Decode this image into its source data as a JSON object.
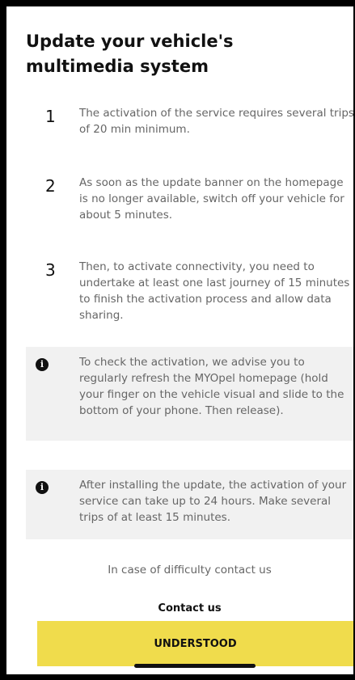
{
  "page": {
    "title": "Update your vehicle's multimedia system"
  },
  "steps": [
    {
      "number": "1",
      "text": "The activation of the service requires several trips of 20 min minimum."
    },
    {
      "number": "2",
      "text": "As soon as the update banner on the homepage is no longer available, switch off your vehicle for about 5 minutes."
    },
    {
      "number": "3",
      "text": "Then, to activate connectivity, you need to undertake at least one last journey of 15 minutes to finish the activation process and allow data sharing."
    }
  ],
  "info_boxes": [
    {
      "icon": "info-icon",
      "text": "To check the activation, we advise you to regularly refresh the MYOpel homepage (hold your finger on the vehicle visual and slide to the bottom of your phone. Then release)."
    },
    {
      "icon": "info-icon",
      "text": "After installing the update, the activation of your service can take up to 24 hours. Make several trips of at least 15 minutes."
    }
  ],
  "footer": {
    "difficulty_text": "In case of difficulty contact us",
    "contact_label": "Contact us",
    "understood_label": "UNDERSTOOD"
  },
  "colors": {
    "accent": "#f0dc4c",
    "info_background": "#f1f1f1",
    "body_text": "#666666",
    "heading_text": "#111111"
  }
}
